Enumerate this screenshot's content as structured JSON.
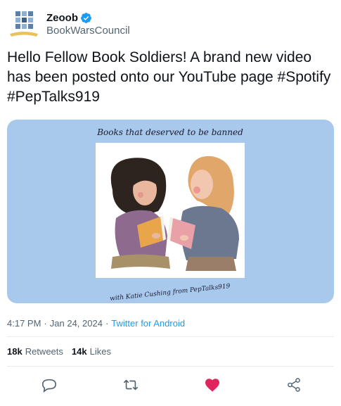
{
  "user": {
    "display_name": "Zeoob",
    "handle": "BookWarsCouncil",
    "verified": true,
    "avatar_icon": "book-wars-council-logo"
  },
  "tweet": {
    "text": "Hello Fellow Book Soldiers! A brand new video has been posted onto our YouTube page #Spotify #PepTalks919"
  },
  "media": {
    "top_caption": "Books that deserved to be banned",
    "bottom_caption": "with Katie Cushing from PepTalks919",
    "background_color": "#a8c8ec"
  },
  "meta": {
    "time": "4:17 PM",
    "date": "Jan 24, 2024",
    "separator": "·",
    "source": "Twitter for Android"
  },
  "stats": {
    "retweets_count": "18k",
    "retweets_label": "Retweets",
    "likes_count": "14k",
    "likes_label": "Likes"
  },
  "actions": [
    {
      "name": "reply",
      "icon": "comment-icon"
    },
    {
      "name": "retweet",
      "icon": "retweet-icon"
    },
    {
      "name": "like",
      "icon": "heart-icon",
      "active": true,
      "color": "#e0245e"
    },
    {
      "name": "share",
      "icon": "share-icon"
    }
  ],
  "colors": {
    "accent": "#1d9bf0",
    "text": "#0f1419",
    "secondary": "#536471",
    "like": "#e0245e"
  }
}
